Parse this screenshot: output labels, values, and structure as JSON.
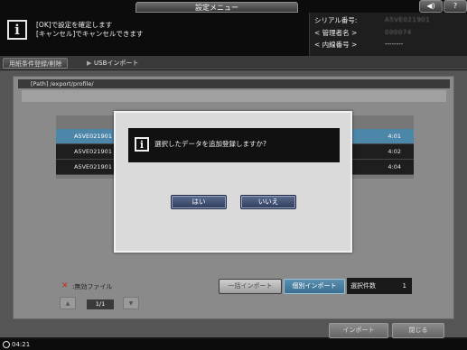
{
  "header": {
    "menu_title": "設定メニュー",
    "message_line1": "[OK]で設定を確定します",
    "message_line2": "[キャンセル]でキャンセルできます",
    "serial_label": "シリアル番号:",
    "serial_value": "A5VE021901",
    "manager_label": "< 管理者名 >",
    "manager_value": "000074",
    "extension_label": "< 内線番号 >",
    "extension_value": "--------",
    "volume_icon": "◀)",
    "help_label": "?"
  },
  "breadcrumb": {
    "item1": "用紙条件登録/削除",
    "item2": "USBインポート"
  },
  "path": "[Path] /export/profile/",
  "list": {
    "rows": [
      {
        "left": "A5VE021901",
        "right": "4:01",
        "selected": true
      },
      {
        "left": "A5VE021901",
        "right": "4:02",
        "selected": false
      },
      {
        "left": "A5VE021901",
        "right": "4:04",
        "selected": false
      }
    ]
  },
  "controls": {
    "invalid_mark": "✕",
    "invalid_label": ":無効ファイル",
    "page_indicator": "1/1",
    "bulk_import": "一括インポート",
    "individual_import": "個別インポート",
    "selection_count_label": "選択件数",
    "selection_count_value": "1",
    "import_button": "インポート",
    "close_button": "閉じる"
  },
  "footer": {
    "time": "04:21"
  },
  "dialog": {
    "message": "選択したデータを追加登録しますか?",
    "yes": "はい",
    "no": "いいえ"
  },
  "colors": {
    "accent_blue": "#4c86a8",
    "dialog_button": "#3e4e72",
    "invalid_red": "#c8261a"
  }
}
